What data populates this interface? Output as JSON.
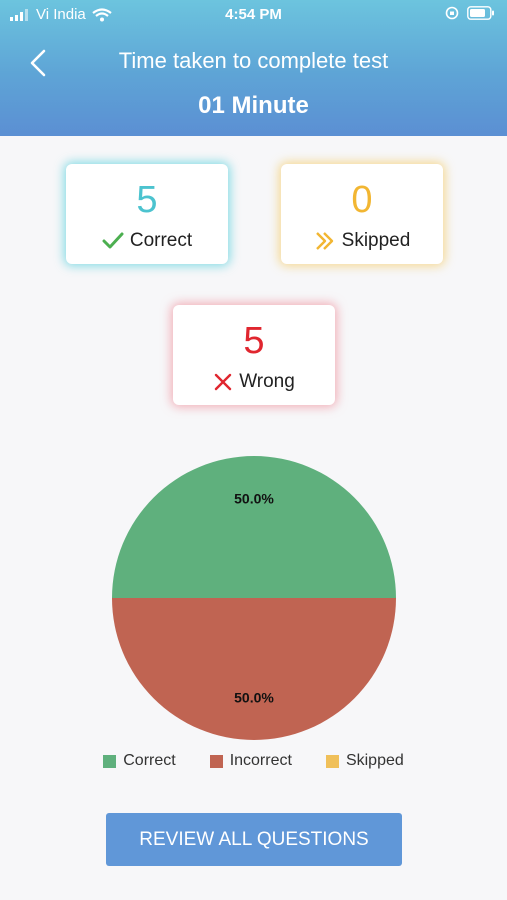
{
  "status_bar": {
    "carrier": "Vi India",
    "time": "4:54 PM"
  },
  "header": {
    "title": "Time taken to complete test",
    "duration": "01 Minute",
    "back_icon": "chevron-left-icon"
  },
  "stats": {
    "correct": {
      "value": "5",
      "label": "Correct",
      "color": "#4cc3cf",
      "icon": "check-icon"
    },
    "skipped": {
      "value": "0",
      "label": "Skipped",
      "color": "#f2b632",
      "icon": "double-chevron-right-icon"
    },
    "wrong": {
      "value": "5",
      "label": "Wrong",
      "color": "#e0262f",
      "icon": "cross-icon"
    }
  },
  "chart_data": {
    "type": "pie",
    "title": "",
    "slices": [
      {
        "label": "Correct",
        "value": 50.0,
        "display": "50.0%",
        "color": "#5fb07d"
      },
      {
        "label": "Incorrect",
        "value": 50.0,
        "display": "50.0%",
        "color": "#c06452"
      },
      {
        "label": "Skipped",
        "value": 0,
        "display": "",
        "color": "#f0c05a"
      }
    ],
    "legend": [
      "Correct",
      "Incorrect",
      "Skipped"
    ],
    "legend_position": "bottom"
  },
  "review_button": {
    "label": "REVIEW ALL QUESTIONS"
  }
}
